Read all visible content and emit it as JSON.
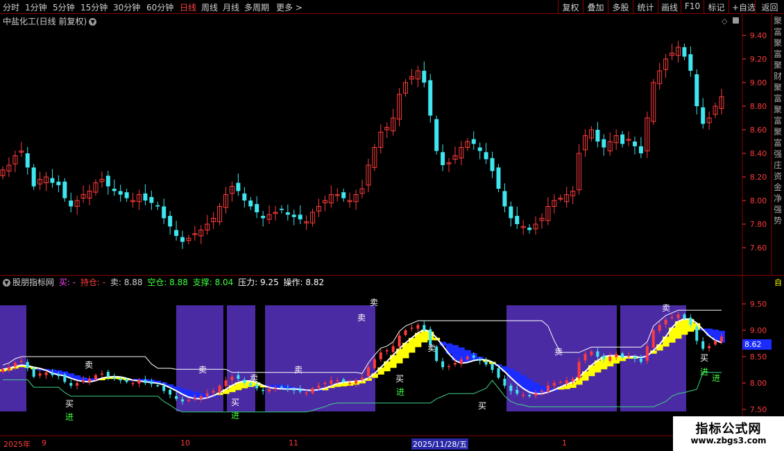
{
  "toolbar": {
    "left": [
      "分时",
      "1分钟",
      "5分钟",
      "15分钟",
      "30分钟",
      "60分钟",
      "日线",
      "周线",
      "月线",
      "多周期",
      "更多 >"
    ],
    "active_index": 6,
    "right": [
      "复权",
      "叠加",
      "多股",
      "统计",
      "画线",
      "F10",
      "标记",
      "+自选",
      "返回"
    ]
  },
  "chart": {
    "title": "中盐化工(日线 前复权)",
    "price_ticks": [
      "9.40",
      "9.20",
      "9.00",
      "8.80",
      "8.60",
      "8.40",
      "8.20",
      "8.00",
      "7.80",
      "7.60"
    ]
  },
  "indicator": {
    "name": "股朋指标网",
    "items": [
      {
        "text": "买: -",
        "color": "#ff40ff"
      },
      {
        "text": "持仓: -",
        "color": "#ff3b3b"
      },
      {
        "text": "卖: 8.88",
        "color": "#d0d0d0"
      },
      {
        "text": "空仓: 8.88",
        "color": "#40ff40"
      },
      {
        "text": "支撑: 8.04",
        "color": "#40ff40"
      },
      {
        "text": "压力: 9.25",
        "color": "#ffffff"
      },
      {
        "text": "操作: 8.82",
        "color": "#ffffff"
      }
    ],
    "ticks": [
      "9.50",
      "9.00",
      "8.50",
      "8.00",
      "7.50"
    ],
    "current_value": "8.62",
    "signals": {
      "buy": "买",
      "sell": "卖",
      "enter": "进"
    }
  },
  "dates": [
    {
      "text": "2025年",
      "pos": 5
    },
    {
      "text": "9",
      "pos": 60
    },
    {
      "text": "10",
      "pos": 260
    },
    {
      "text": "11",
      "pos": 416
    },
    {
      "text": "2025/11/28/五",
      "pos": 593,
      "highlight": true
    },
    {
      "text": "1",
      "pos": 810
    }
  ],
  "side_text": "聚富聚富聚财聚富聚富聚富强庄资金净强势",
  "watermark": {
    "title": "指标公式网",
    "url": "www.zbgs3.com"
  },
  "colors": {
    "up": "#ff3b3b",
    "down": "#3fe6ef",
    "band": "#4b2ba3",
    "support": "#3fd48a",
    "pressure": "#ffffff",
    "blue_line": "#1a2cff",
    "yellow": "#ffff00"
  }
}
